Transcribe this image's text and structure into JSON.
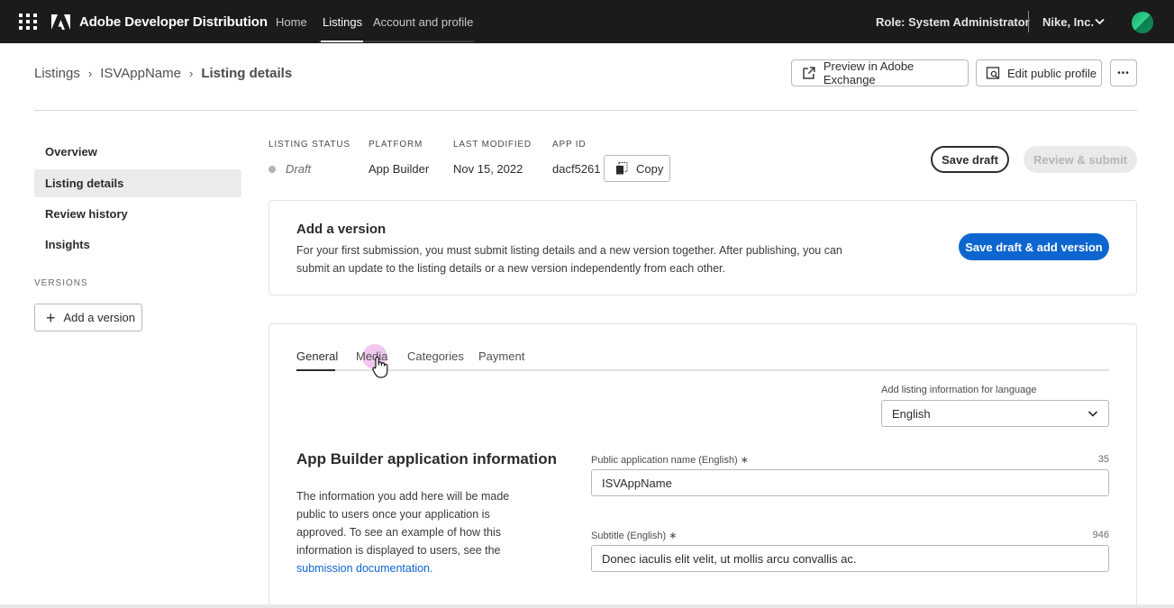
{
  "topbar": {
    "app_name": "Adobe Developer Distribution",
    "nav": [
      "Home",
      "Listings",
      "Account and profile"
    ],
    "role": "Role: System Administrator",
    "org": "Nike, Inc."
  },
  "breadcrumb": {
    "items": [
      "Listings",
      "ISVAppName",
      "Listing details"
    ]
  },
  "header_actions": {
    "preview": "Preview in Adobe Exchange",
    "edit_profile": "Edit public profile",
    "more": "•••"
  },
  "sidenav": {
    "items": [
      "Overview",
      "Listing details",
      "Review history",
      "Insights"
    ],
    "versions_label": "VERSIONS",
    "add_version": "Add a version"
  },
  "meta": {
    "status_label": "LISTING STATUS",
    "status_value": "Draft",
    "platform_label": "PLATFORM",
    "platform_value": "App Builder",
    "modified_label": "LAST MODIFIED",
    "modified_value": "Nov 15, 2022",
    "appid_label": "APP ID",
    "appid_value": "dacf5261",
    "copy": "Copy"
  },
  "actions": {
    "save_draft": "Save draft",
    "review_submit": "Review & submit"
  },
  "add_version_card": {
    "title": "Add a version",
    "body": "For your first submission, you must submit listing details and a new version together. After publishing, you can submit an update to the listing details or a new version independently from each other.",
    "button": "Save draft & add version"
  },
  "tabs": [
    "General",
    "Media",
    "Categories",
    "Payment"
  ],
  "language": {
    "label": "Add listing information for language",
    "value": "English"
  },
  "section": {
    "title": "App Builder application information",
    "desc": "The information you add here will be made public to users once your application is approved. To see an example of how this information is displayed to users, see the",
    "link": "submission documentation."
  },
  "fields": {
    "name_label": "Public application name (English) ∗",
    "name_count": "35",
    "name_value": "ISVAppName",
    "subtitle_label": "Subtitle (English) ∗",
    "subtitle_count": "946",
    "subtitle_value": "Donec iaculis elit velit, ut mollis arcu convallis ac."
  },
  "colors": {
    "topbar": "#1b1b1b",
    "primary": "#0d66d0",
    "cursor_halo": "#df82dc"
  }
}
